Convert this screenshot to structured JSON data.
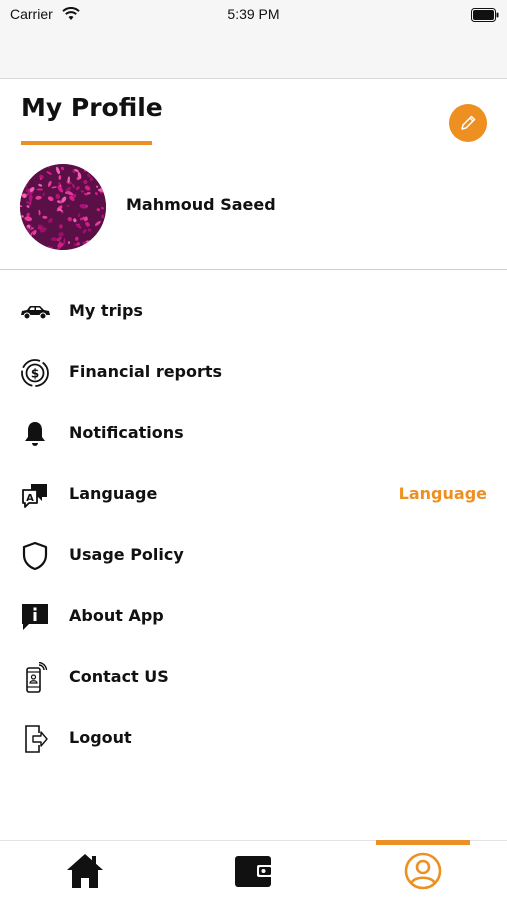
{
  "status_bar": {
    "carrier": "Carrier",
    "time": "5:39 PM"
  },
  "profile": {
    "title": "My Profile",
    "user_name": "Mahmoud Saeed",
    "edit_icon": "pencil-icon",
    "avatar_image": "flower-photo"
  },
  "menu": [
    {
      "id": "my-trips",
      "label": "My trips",
      "icon": "car-icon"
    },
    {
      "id": "financial-reports",
      "label": "Financial reports",
      "icon": "dollar-coin-icon"
    },
    {
      "id": "notifications",
      "label": "Notifications",
      "icon": "bell-icon"
    },
    {
      "id": "language",
      "label": "Language",
      "icon": "translate-icon",
      "value": "Language"
    },
    {
      "id": "usage-policy",
      "label": "Usage Policy",
      "icon": "shield-icon"
    },
    {
      "id": "about-app",
      "label": "About App",
      "icon": "info-icon"
    },
    {
      "id": "contact-us",
      "label": "Contact US",
      "icon": "phone-contact-icon"
    },
    {
      "id": "logout",
      "label": "Logout",
      "icon": "logout-icon"
    }
  ],
  "tabs": [
    {
      "id": "home",
      "icon": "home-icon",
      "active": false
    },
    {
      "id": "wallet",
      "icon": "wallet-icon",
      "active": false
    },
    {
      "id": "profile",
      "icon": "user-circle-icon",
      "active": true
    }
  ],
  "colors": {
    "accent": "#ee9021",
    "text": "#111111",
    "avatar_bg": "#7d1260"
  }
}
